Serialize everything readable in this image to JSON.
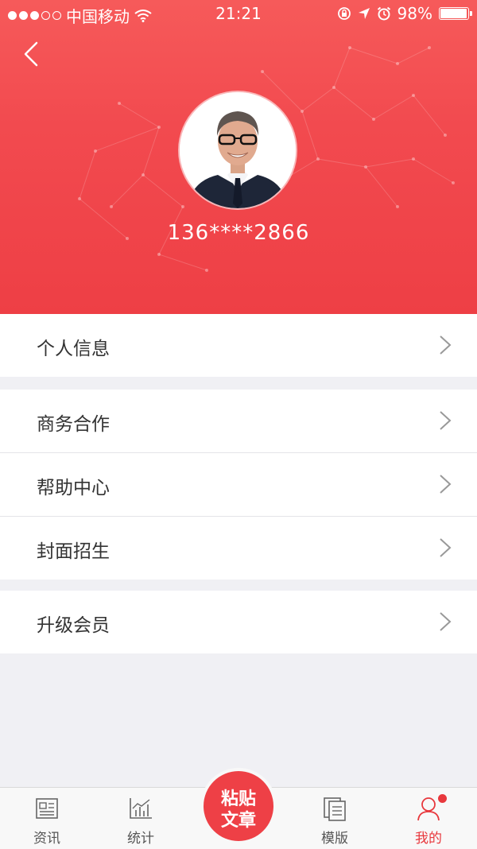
{
  "status_bar": {
    "carrier": "中国移动",
    "time": "21:21",
    "battery": "98%",
    "battery_level": 0.98
  },
  "profile": {
    "phone": "136****2866"
  },
  "menu_groups": [
    {
      "items": [
        {
          "label": "个人信息"
        }
      ]
    },
    {
      "items": [
        {
          "label": "商务合作"
        },
        {
          "label": "帮助中心"
        },
        {
          "label": "封面招生"
        }
      ]
    },
    {
      "items": [
        {
          "label": "升级会员"
        }
      ]
    }
  ],
  "tab_bar": {
    "tabs": [
      {
        "label": "资讯",
        "icon": "news-icon"
      },
      {
        "label": "统计",
        "icon": "chart-icon"
      },
      {
        "label": "模版",
        "icon": "template-icon"
      },
      {
        "label": "我的",
        "icon": "user-icon",
        "active": true,
        "badge": true
      }
    ],
    "center_button": {
      "line1": "粘贴",
      "line2": "文章"
    }
  },
  "colors": {
    "accent": "#e8383d",
    "header": "#f24a4f"
  }
}
